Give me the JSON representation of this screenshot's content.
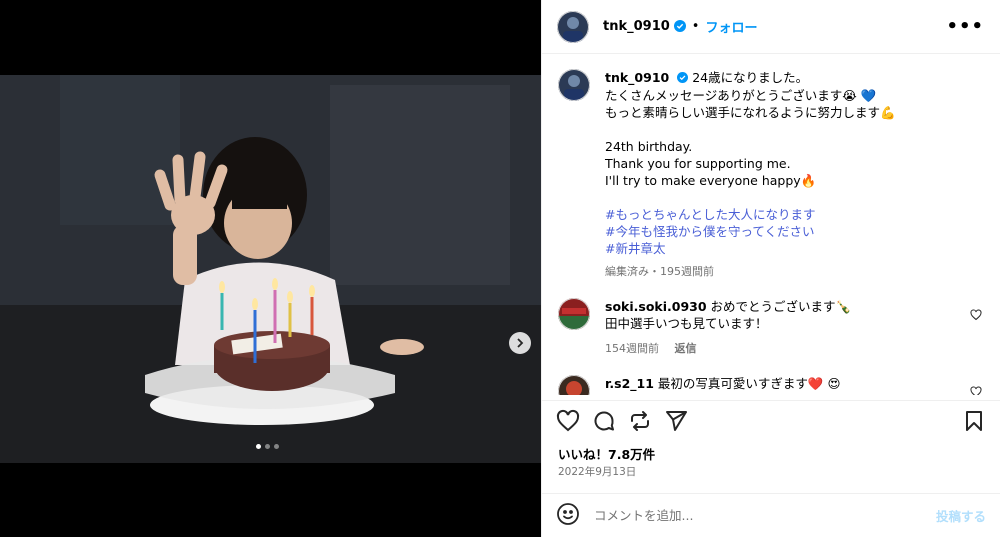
{
  "post": {
    "username": "tnk_0910",
    "follow_label": "フォロー",
    "separator": "•",
    "more_label": "•••"
  },
  "caption": {
    "username": "tnk_0910",
    "line1": "24歳になりました。",
    "line2": "たくさんメッセージありがとうございます😭 💙",
    "line3": "もっと素晴らしい選手になれるように努力します💪",
    "line4": "24th birthday.",
    "line5": "Thank you for supporting me.",
    "line6": "I'll try to make everyone happy🔥",
    "hashtags": [
      "#もっとちゃんとした大人になります",
      "#今年も怪我から僕を守ってください",
      "#新井章太"
    ],
    "meta": "編集済み・195週間前"
  },
  "comments": [
    {
      "username": "soki.soki.0930",
      "text": "おめでとうございます🍾",
      "text2": "田中選手いつも見ています！",
      "time": "154週間前",
      "reply": "返信"
    },
    {
      "username": "r.s2_11",
      "text": "最初の写真可愛いすぎます❤️ 😍"
    }
  ],
  "likes": "いいね！7.8万件",
  "date": "2022年9月13日",
  "add_comment": {
    "placeholder": "コメントを追加...",
    "post_label": "投稿する"
  },
  "carousel": {
    "count": 3,
    "active": 0
  },
  "colors": {
    "accent": "#0095f6",
    "hashtag": "#4a5fd6",
    "verified": "#0095f6",
    "muted": "#737373"
  },
  "icons": [
    "verified-icon",
    "more-icon",
    "heart-icon",
    "comment-icon",
    "share-icon",
    "send-icon",
    "bookmark-icon",
    "emoji-icon",
    "chevron-right-icon"
  ]
}
